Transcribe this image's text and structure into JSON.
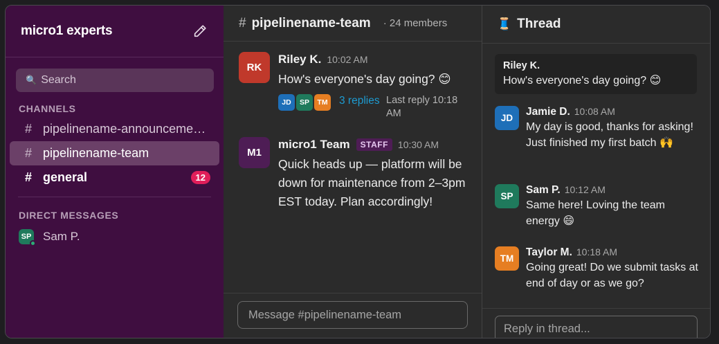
{
  "workspace": {
    "name": "micro1 experts"
  },
  "sidebar": {
    "search_placeholder": "Search",
    "channels_label": "CHANNELS",
    "channels": [
      {
        "name": "pipelinename-announcements",
        "active": false,
        "bold": false
      },
      {
        "name": "pipelinename-team",
        "active": true,
        "bold": false
      },
      {
        "name": "general",
        "active": false,
        "bold": true,
        "badge": "12"
      }
    ],
    "dm_label": "DIRECT MESSAGES",
    "dms": [
      {
        "initials": "SP",
        "name": "Sam P.",
        "online": true
      }
    ]
  },
  "channel": {
    "name": "pipelinename-team",
    "members": "· 24 members",
    "messages": [
      {
        "initials": "RK",
        "author": "Riley K.",
        "time": "10:02 AM",
        "text": "How's everyone's day going? 😊",
        "avatar_color": "#c0392b",
        "thread": {
          "participants": [
            {
              "initials": "JD",
              "color": "#1e6fb8"
            },
            {
              "initials": "SP",
              "color": "#1f7a5c"
            },
            {
              "initials": "TM",
              "color": "#e67e22"
            }
          ],
          "replies": "3 replies",
          "last_reply": "Last reply 10:18 AM"
        }
      },
      {
        "initials": "M1",
        "author": "micro1 Team",
        "badge": "STAFF",
        "time": "10:30 AM",
        "text": "Quick heads up — platform will be down for maintenance from 2–3pm EST today. Plan accordingly!",
        "avatar_color": "#4e1d55"
      }
    ],
    "composer_placeholder": "Message #pipelinename-team"
  },
  "thread": {
    "icon": "🧵",
    "title": "Thread",
    "parent": {
      "author": "Riley K.",
      "text": "How's everyone's day going? 😊"
    },
    "replies": [
      {
        "initials": "JD",
        "author": "Jamie D.",
        "time": "10:08 AM",
        "text": "My day is good, thanks for asking! Just finished my first batch 🙌",
        "color": "#1e6fb8"
      },
      {
        "initials": "SP",
        "author": "Sam P.",
        "time": "10:12 AM",
        "text": "Same here! Loving the team energy 😄",
        "color": "#1f7a5c"
      },
      {
        "initials": "TM",
        "author": "Taylor M.",
        "time": "10:18 AM",
        "text": "Going great! Do we submit tasks at end of day or as we go?",
        "color": "#e67e22"
      }
    ],
    "reply_placeholder": "Reply in thread..."
  }
}
